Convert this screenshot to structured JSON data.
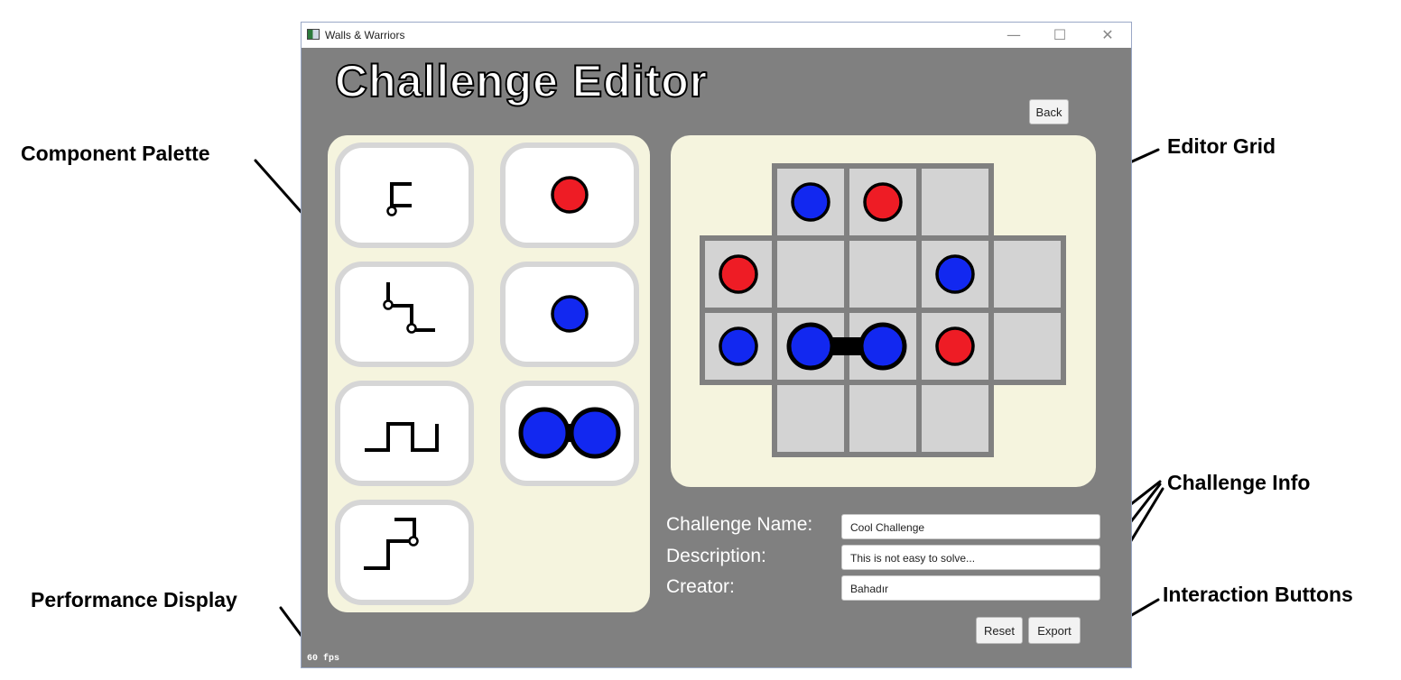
{
  "window": {
    "title": "Walls & Warriors"
  },
  "heading": "Challenge Editor",
  "back_label": "Back",
  "callouts": {
    "palette": "Component Palette",
    "grid": "Editor Grid",
    "info": "Challenge Info",
    "buttons": "Interaction Buttons",
    "performance": "Performance Display"
  },
  "palette": {
    "items": [
      {
        "icon": "wall-piece-bracket-icon"
      },
      {
        "icon": "red-knight-icon"
      },
      {
        "icon": "wall-piece-step-icon"
      },
      {
        "icon": "blue-knight-icon"
      },
      {
        "icon": "wall-piece-square-wave-icon"
      },
      {
        "icon": "linked-blue-knights-icon"
      },
      {
        "icon": "wall-piece-hook-icon"
      }
    ]
  },
  "grid": {
    "cells": [
      [
        "",
        "blue",
        "red",
        "",
        ""
      ],
      [
        "red",
        "",
        "",
        "blue",
        ""
      ],
      [
        "blue",
        "pair-left",
        "pair-right",
        "red",
        ""
      ],
      [
        "",
        "",
        "",
        "",
        ""
      ]
    ],
    "colors": {
      "red": "#ee1c25",
      "blue": "#1228f0",
      "cell": "#d3d3d3",
      "border": "#808080"
    }
  },
  "info": {
    "name_label": "Challenge Name:",
    "name_value": "Cool Challenge",
    "description_label": "Description:",
    "description_value": "This is not easy to solve...",
    "creator_label": "Creator:",
    "creator_value": "Bahadır"
  },
  "buttons": {
    "reset": "Reset",
    "export": "Export"
  },
  "fps": "60 fps"
}
